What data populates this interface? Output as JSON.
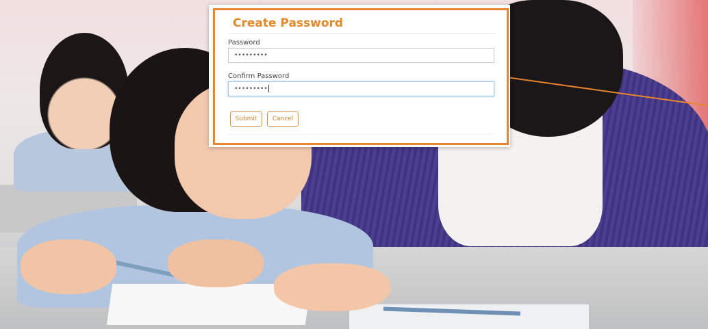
{
  "dialog": {
    "title": "Create Password",
    "fields": [
      {
        "label": "Password",
        "value": "•••••••••",
        "focused": false
      },
      {
        "label": "Confirm Password",
        "value": "•••••••••",
        "focused": true
      }
    ],
    "buttons": {
      "submit": "Submit",
      "cancel": "Cancel"
    }
  },
  "colors": {
    "accent": "#e8852e",
    "title": "#e08a2b",
    "button_border": "#d98b3c",
    "focus_border": "#9ec6e6"
  },
  "background": {
    "icon": "classroom-photo"
  }
}
